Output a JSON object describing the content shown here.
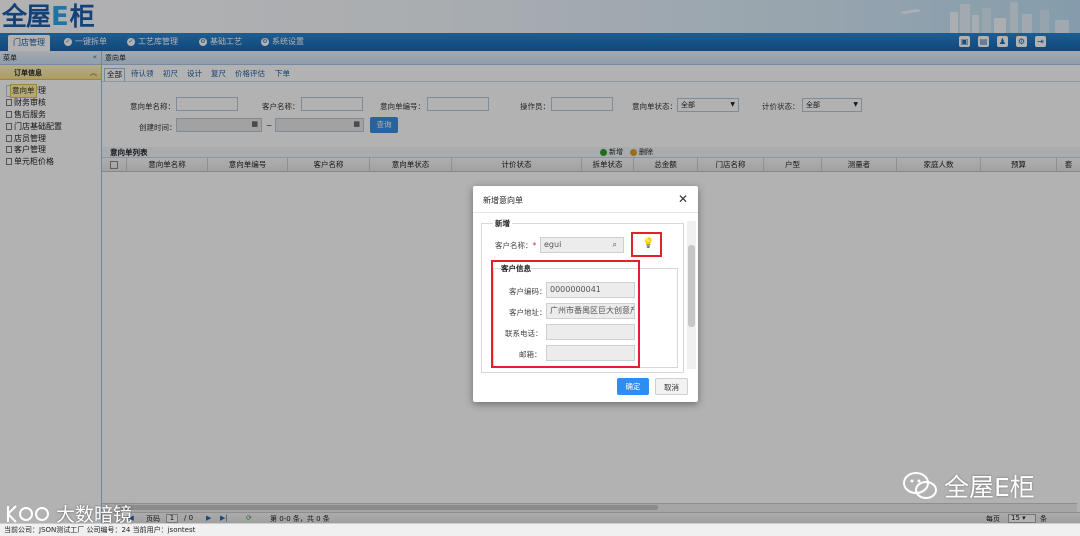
{
  "logo": {
    "part1": "全屋",
    "part2": "E",
    "part3": "柜"
  },
  "nav": {
    "items": [
      {
        "label": "门店管理",
        "icon": "store-icon"
      },
      {
        "label": "一键拆单",
        "icon": "check-circle-icon"
      },
      {
        "label": "工艺库管理",
        "icon": "check-circle-icon"
      },
      {
        "label": "基础工艺",
        "icon": "settings-circle-icon"
      },
      {
        "label": "系统设置",
        "icon": "settings-circle-icon"
      }
    ],
    "right_icons": [
      "screen-icon",
      "clipboard-icon",
      "user-icon",
      "gear-icon",
      "exit-icon"
    ]
  },
  "sidebar": {
    "header": "菜单",
    "collapse_glyph": "«",
    "group_title": "订单信息",
    "group_toggle_glyph": "︽",
    "items": [
      "意向单",
      "订单管理",
      "财务审核",
      "售后服务",
      "门店基础配置",
      "店员管理",
      "客户管理",
      "单元柜价格"
    ]
  },
  "main": {
    "tab_title": "意向单",
    "subtabs": [
      "全部",
      "待认领",
      "初尺",
      "设计",
      "复尺",
      "价格评估",
      "下单"
    ],
    "filters": {
      "intent_name": "意向单名称：",
      "customer_name": "客户名称：",
      "intent_no": "意向单编号：",
      "operator": "操作员：",
      "intent_status": "意向单状态：",
      "intent_status_value": "全部",
      "price_status": "计价状态：",
      "price_status_value": "全部",
      "created_time": "创建时间：",
      "range_sep": "~",
      "query_button": "查询"
    },
    "grid": {
      "title": "意向单列表",
      "add_label": "新增",
      "delete_label": "删除",
      "columns": [
        "意向单名称",
        "意向单编号",
        "客户名称",
        "意向单状态",
        "计价状态",
        "拆单状态",
        "总金额",
        "门店名称",
        "户型",
        "测量者",
        "家庭人数",
        "预算",
        "套"
      ]
    },
    "pager": {
      "page_label": "页码",
      "page_value": "1",
      "total_pages": "/ 0",
      "range_text": "第 0-0 条，共 0 条",
      "page_size_label": "每页",
      "page_size_value": "15",
      "page_size_suffix": "条"
    }
  },
  "status_bar": "当前公司：JSON测试工厂    公司编号：24    当前用户：jsontest",
  "modal": {
    "title": "新增意向单",
    "section_new": "新增",
    "customer_name_label": "客户名称：",
    "required_mark": "*",
    "customer_name_value": "egui",
    "section_customer": "客户信息",
    "customer_no_label": "客户编码：",
    "customer_no_value": "0000000041",
    "address_label": "客户地址：",
    "address_value": "广州市番禺区巨大创意产",
    "phone_label": "联系电话：",
    "phone_value": "",
    "email_label": "邮箱：",
    "email_value": "",
    "confirm_button": "确定",
    "cancel_button": "取消"
  },
  "watermarks": {
    "wechat": "全屋E柜",
    "datalink": "大数暗镜"
  },
  "colors": {
    "nav_blue": "#1a6fbd",
    "highlight_red": "#e5202a",
    "confirm_blue": "#2f8cf0"
  }
}
